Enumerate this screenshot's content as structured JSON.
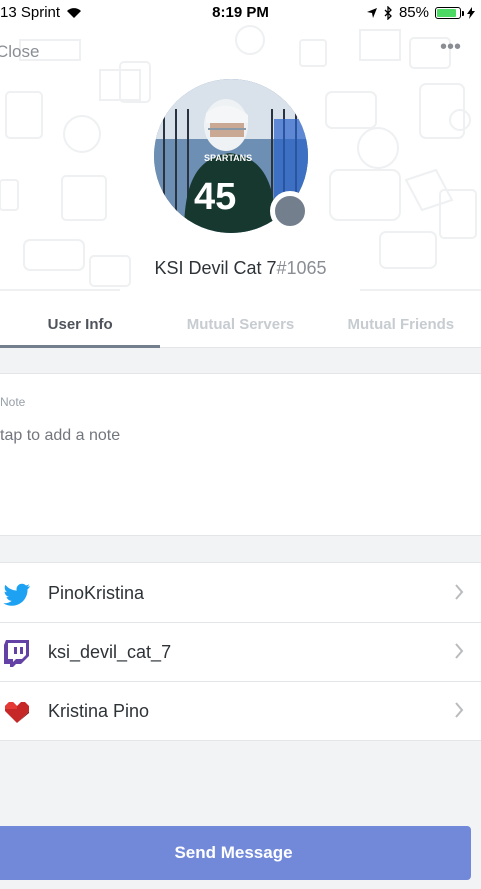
{
  "status_bar": {
    "carrier": "13 Sprint",
    "time": "8:19 PM",
    "battery": "85%",
    "battery_level": 0.85,
    "icons": [
      "wifi-icon",
      "location-icon",
      "bluetooth-icon",
      "battery-icon",
      "charging-icon"
    ]
  },
  "nav": {
    "close_label": "Close",
    "more_label": "•••"
  },
  "profile": {
    "username": "KSI Devil Cat 7",
    "discriminator": "#1065",
    "status_color": "#747f8d"
  },
  "tabs": [
    {
      "label": "User Info",
      "active": true
    },
    {
      "label": "Mutual Servers",
      "active": false
    },
    {
      "label": "Mutual Friends",
      "active": false
    }
  ],
  "note": {
    "label": "Note",
    "placeholder": "tap to add a note"
  },
  "connections": [
    {
      "icon": "twitter-icon",
      "name": "PinoKristina"
    },
    {
      "icon": "twitch-icon",
      "name": "ksi_devil_cat_7"
    },
    {
      "icon": "patreon-heart-icon",
      "name": "Kristina Pino"
    }
  ],
  "actions": {
    "send_message_label": "Send Message"
  },
  "colors": {
    "accent": "#7289da",
    "twitter": "#1da1f2",
    "twitch": "#6441a4",
    "heart": "#d32f2f"
  }
}
